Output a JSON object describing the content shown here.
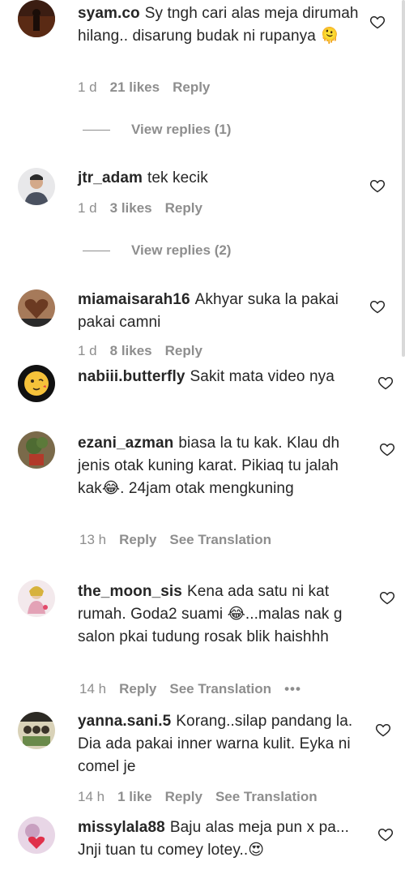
{
  "comments": [
    {
      "username": "syam.co",
      "text": "Sy tngh cari alas meja dirumah hilang.. disarung budak ni rupanya 🫠",
      "time": "1 d",
      "likes": "21 likes",
      "reply": "Reply",
      "view_replies": "View replies (1)"
    },
    {
      "username": "jtr_adam",
      "text": "tek kecik",
      "time": "1 d",
      "likes": "3 likes",
      "reply": "Reply",
      "view_replies": "View replies (2)"
    },
    {
      "username": "miamaisarah16",
      "text": "Akhyar suka la pakai pakai camni",
      "time": "1 d",
      "likes": "8 likes",
      "reply": "Reply"
    },
    {
      "username": "nabiii.butterfly",
      "text": "Sakit mata video nya"
    },
    {
      "username": "ezani_azman",
      "text": "biasa la tu kak. Klau dh jenis otak kuning karat. Pikiaq tu jalah kak😂. 24jam otak mengkuning",
      "time": "13 h",
      "reply": "Reply",
      "translation": "See Translation"
    },
    {
      "username": "the_moon_sis",
      "text": "Kena ada satu ni kat rumah. Goda2 suami 😂...malas nak g salon pkai tudung rosak blik haishhh",
      "time": "14 h",
      "reply": "Reply",
      "translation": "See Translation",
      "more": "•••"
    },
    {
      "username": "yanna.sani.5",
      "text": "Korang..silap pandang la. Dia ada pakai inner warna kulit. Eyka ni comel je",
      "time": "14 h",
      "likes": "1 like",
      "reply": "Reply",
      "translation": "See Translation"
    },
    {
      "username": "missylala88",
      "text": "Baju alas meja pun x pa... Jnji tuan tu comey lotey..😍"
    }
  ],
  "icons": {
    "heart": "heart-outline-icon",
    "more": "more-dots-icon"
  },
  "colors": {
    "text": "#262626",
    "secondary": "#8e8e8e"
  }
}
